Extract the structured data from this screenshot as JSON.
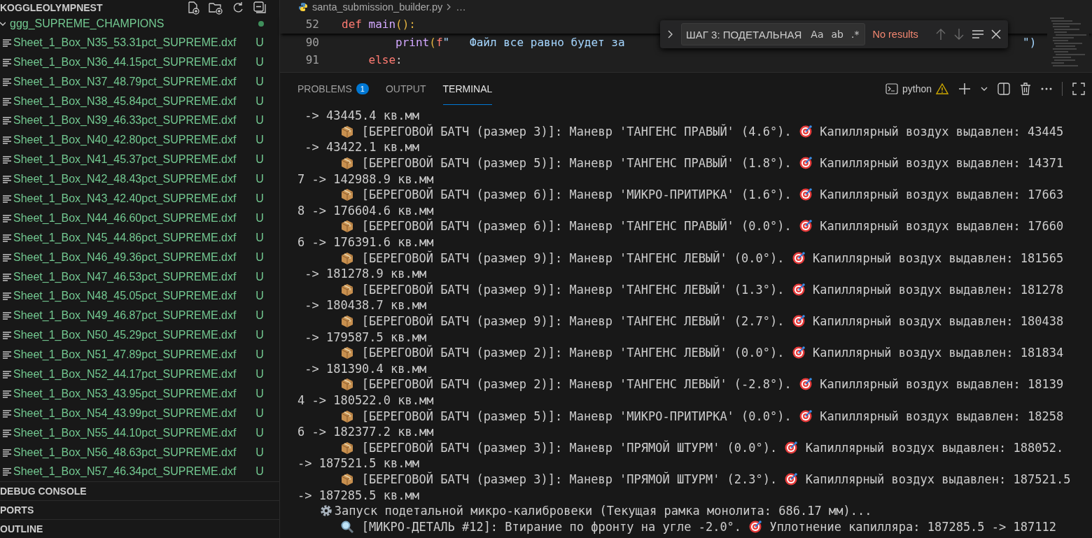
{
  "explorer": {
    "title": "KOGGLEOLYMPNEST",
    "folder": {
      "name": "ggg_SUPREME_CHAMPIONS",
      "expanded": true
    },
    "files": [
      {
        "name": "Sheet_1_Box_N35_53.31pct_SUPREME.dxf",
        "status": "U"
      },
      {
        "name": "Sheet_1_Box_N36_44.15pct_SUPREME.dxf",
        "status": "U"
      },
      {
        "name": "Sheet_1_Box_N37_48.79pct_SUPREME.dxf",
        "status": "U"
      },
      {
        "name": "Sheet_1_Box_N38_45.84pct_SUPREME.dxf",
        "status": "U"
      },
      {
        "name": "Sheet_1_Box_N39_46.33pct_SUPREME.dxf",
        "status": "U"
      },
      {
        "name": "Sheet_1_Box_N40_42.80pct_SUPREME.dxf",
        "status": "U"
      },
      {
        "name": "Sheet_1_Box_N41_45.37pct_SUPREME.dxf",
        "status": "U"
      },
      {
        "name": "Sheet_1_Box_N42_48.43pct_SUPREME.dxf",
        "status": "U"
      },
      {
        "name": "Sheet_1_Box_N43_42.40pct_SUPREME.dxf",
        "status": "U"
      },
      {
        "name": "Sheet_1_Box_N44_46.60pct_SUPREME.dxf",
        "status": "U"
      },
      {
        "name": "Sheet_1_Box_N45_44.86pct_SUPREME.dxf",
        "status": "U"
      },
      {
        "name": "Sheet_1_Box_N46_49.36pct_SUPREME.dxf",
        "status": "U"
      },
      {
        "name": "Sheet_1_Box_N47_46.53pct_SUPREME.dxf",
        "status": "U"
      },
      {
        "name": "Sheet_1_Box_N48_45.05pct_SUPREME.dxf",
        "status": "U"
      },
      {
        "name": "Sheet_1_Box_N49_46.87pct_SUPREME.dxf",
        "status": "U"
      },
      {
        "name": "Sheet_1_Box_N50_45.29pct_SUPREME.dxf",
        "status": "U"
      },
      {
        "name": "Sheet_1_Box_N51_47.89pct_SUPREME.dxf",
        "status": "U"
      },
      {
        "name": "Sheet_1_Box_N52_44.17pct_SUPREME.dxf",
        "status": "U"
      },
      {
        "name": "Sheet_1_Box_N53_43.95pct_SUPREME.dxf",
        "status": "U"
      },
      {
        "name": "Sheet_1_Box_N54_43.99pct_SUPREME.dxf",
        "status": "U"
      },
      {
        "name": "Sheet_1_Box_N55_44.10pct_SUPREME.dxf",
        "status": "U"
      },
      {
        "name": "Sheet_1_Box_N56_48.63pct_SUPREME.dxf",
        "status": "U"
      },
      {
        "name": "Sheet_1_Box_N57_46.34pct_SUPREME.dxf",
        "status": "U"
      }
    ],
    "sections": [
      "DEBUG CONSOLE",
      "PORTS",
      "OUTLINE"
    ]
  },
  "editor": {
    "breadcrumb": {
      "file": "santa_submission_builder.py",
      "rest": "…"
    },
    "lines": [
      {
        "number": "52",
        "sticky": true,
        "tokens": [
          {
            "t": "def",
            "kind": "keyword"
          },
          {
            "t": " main",
            "kind": "function"
          },
          {
            "t": "():",
            "kind": "paren"
          }
        ]
      },
      {
        "number": "90",
        "sticky": false,
        "tokens": [
          {
            "t": "        print",
            "kind": "builtin"
          },
          {
            "t": "(",
            "kind": "paren"
          },
          {
            "t": "f",
            "kind": "keyword"
          },
          {
            "t": "\"   Файл все равно будет за",
            "kind": "string"
          }
        ],
        "tail": "\")"
      },
      {
        "number": "91",
        "sticky": false,
        "tokens": [
          {
            "t": "    else",
            "kind": "keyword"
          },
          {
            "t": ":",
            "kind": "plain"
          }
        ]
      }
    ],
    "find": {
      "query": "ШАГ 3: ПОДЕТАЛЬНАЯ",
      "toggles": [
        "Aa",
        "ab",
        ".*"
      ],
      "result": "No results",
      "navigation_disabled": true
    }
  },
  "panel": {
    "tabs": [
      {
        "label": "PROBLEMS",
        "badge": "1",
        "selected": false
      },
      {
        "label": "OUTPUT",
        "selected": false
      },
      {
        "label": "TERMINAL",
        "selected": true
      }
    ],
    "terminal_name": "python",
    "lines": [
      {
        "kind": "plain",
        "text": " -> 43445.4 кв.мм"
      },
      {
        "kind": "batch",
        "text": "[БЕРЕГОВОЙ БАТЧ (размер 3)]: Маневр 'ТАНГЕНС ПРАВЫЙ' (4.6°).",
        "result": "Капиллярный воздух выдавлен: 43445"
      },
      {
        "kind": "plain",
        "text": " -> 43422.1 кв.мм"
      },
      {
        "kind": "batch",
        "text": "[БЕРЕГОВОЙ БАТЧ (размер 5)]: Маневр 'ТАНГЕНС ПРАВЫЙ' (1.8°).",
        "result": "Капиллярный воздух выдавлен: 14371"
      },
      {
        "kind": "plain",
        "text": "7 -> 142988.9 кв.мм"
      },
      {
        "kind": "batch",
        "text": "[БЕРЕГОВОЙ БАТЧ (размер 6)]: Маневр 'МИКРО-ПРИТИРКА' (1.6°).",
        "result": "Капиллярный воздух выдавлен: 17663"
      },
      {
        "kind": "plain",
        "text": "8 -> 176604.6 кв.мм"
      },
      {
        "kind": "batch",
        "text": "[БЕРЕГОВОЙ БАТЧ (размер 6)]: Маневр 'ТАНГЕНС ПРАВЫЙ' (0.0°).",
        "result": "Капиллярный воздух выдавлен: 17660"
      },
      {
        "kind": "plain",
        "text": "6 -> 176391.6 кв.мм"
      },
      {
        "kind": "batch",
        "text": "[БЕРЕГОВОЙ БАТЧ (размер 9)]: Маневр 'ТАНГЕНС ЛЕВЫЙ' (0.0°).",
        "result": "Капиллярный воздух выдавлен: 181565"
      },
      {
        "kind": "plain",
        "text": " -> 181278.9 кв.мм"
      },
      {
        "kind": "batch",
        "text": "[БЕРЕГОВОЙ БАТЧ (размер 9)]: Маневр 'ТАНГЕНС ЛЕВЫЙ' (1.3°).",
        "result": "Капиллярный воздух выдавлен: 181278"
      },
      {
        "kind": "plain",
        "text": " -> 180438.7 кв.мм"
      },
      {
        "kind": "batch",
        "text": "[БЕРЕГОВОЙ БАТЧ (размер 9)]: Маневр 'ТАНГЕНС ЛЕВЫЙ' (2.7°).",
        "result": "Капиллярный воздух выдавлен: 180438"
      },
      {
        "kind": "plain",
        "text": " -> 179587.5 кв.мм"
      },
      {
        "kind": "batch",
        "text": "[БЕРЕГОВОЙ БАТЧ (размер 2)]: Маневр 'ТАНГЕНС ЛЕВЫЙ' (0.0°).",
        "result": "Капиллярный воздух выдавлен: 181834"
      },
      {
        "kind": "plain",
        "text": " -> 181390.4 кв.мм"
      },
      {
        "kind": "batch",
        "text": "[БЕРЕГОВОЙ БАТЧ (размер 2)]: Маневр 'ТАНГЕНС ЛЕВЫЙ' (-2.8°).",
        "result": "Капиллярный воздух выдавлен: 18139"
      },
      {
        "kind": "plain",
        "text": "4 -> 180522.0 кв.мм"
      },
      {
        "kind": "batch",
        "text": "[БЕРЕГОВОЙ БАТЧ (размер 5)]: Маневр 'МИКРО-ПРИТИРКА' (0.0°).",
        "result": "Капиллярный воздух выдавлен: 18258"
      },
      {
        "kind": "plain",
        "text": "6 -> 182377.2 кв.мм"
      },
      {
        "kind": "batch",
        "text": "[БЕРЕГОВОЙ БАТЧ (размер 3)]: Маневр 'ПРЯМОЙ ШТУРМ' (0.0°).",
        "result": "Капиллярный воздух выдавлен: 188052."
      },
      {
        "kind": "plain",
        "text": "-> 187521.5 кв.мм"
      },
      {
        "kind": "batch",
        "text": "[БЕРЕГОВОЙ БАТЧ (размер 3)]: Маневр 'ПРЯМОЙ ШТУРМ' (2.3°).",
        "result": "Капиллярный воздух выдавлен: 187521.5"
      },
      {
        "kind": "plain",
        "text": "-> 187285.5 кв.мм"
      },
      {
        "kind": "calibrate",
        "text": "Запуск подетальной микро-калибровеки (Текущая рамка монолита: 686.17 мм)..."
      },
      {
        "kind": "detail",
        "text": "[МИКРО-ДЕТАЛЬ #12]: Втирание по фронту на угле -2.0°.",
        "result": "Уплотнение капилляра: 187285.5 -> 187112"
      }
    ]
  }
}
